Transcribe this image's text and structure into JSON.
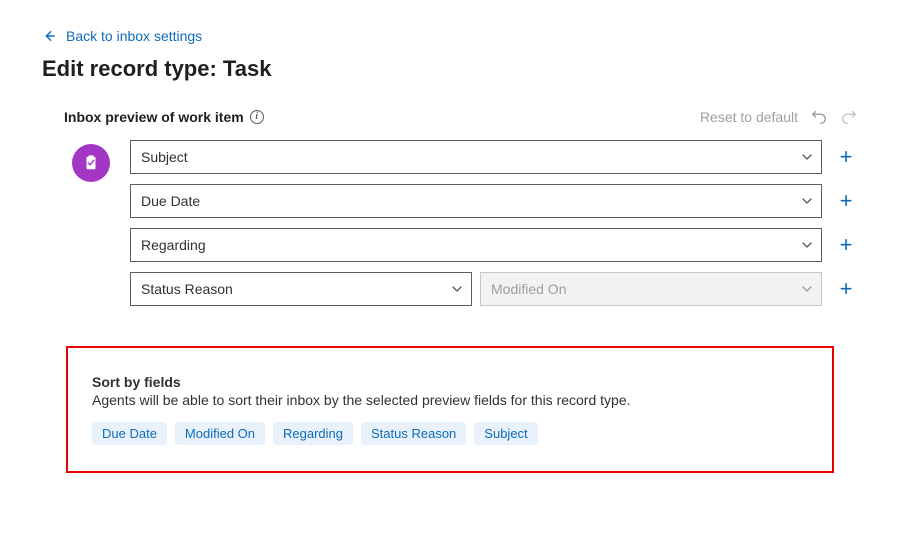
{
  "nav": {
    "back_label": "Back to inbox settings"
  },
  "page": {
    "title": "Edit record type: Task"
  },
  "preview": {
    "section_label": "Inbox preview of work item",
    "reset_label": "Reset to default",
    "rows": [
      {
        "fields": [
          {
            "label": "Subject",
            "disabled": false
          }
        ]
      },
      {
        "fields": [
          {
            "label": "Due Date",
            "disabled": false
          }
        ]
      },
      {
        "fields": [
          {
            "label": "Regarding",
            "disabled": false
          }
        ]
      },
      {
        "fields": [
          {
            "label": "Status Reason",
            "disabled": false
          },
          {
            "label": "Modified On",
            "disabled": true
          }
        ]
      }
    ]
  },
  "sort": {
    "title": "Sort by fields",
    "description": "Agents will be able to sort their inbox by the selected preview fields for this record type.",
    "chips": [
      "Due Date",
      "Modified On",
      "Regarding",
      "Status Reason",
      "Subject"
    ]
  }
}
